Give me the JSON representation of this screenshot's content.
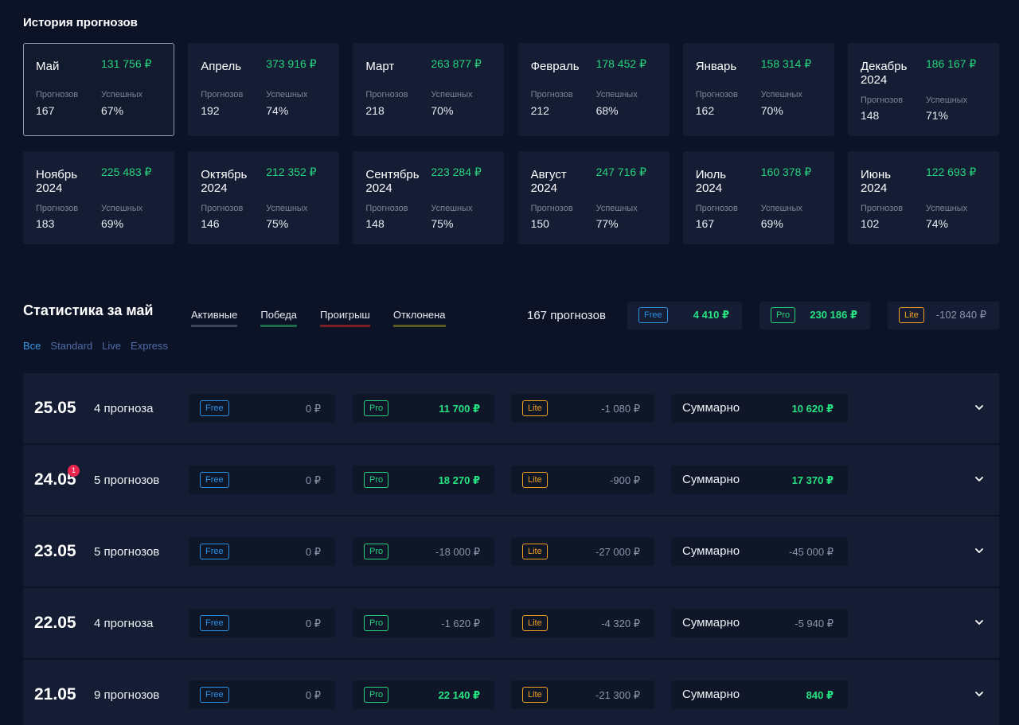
{
  "history": {
    "title": "История прогнозов",
    "labels": {
      "forecasts": "Прогнозов",
      "success": "Успешных"
    },
    "cards": [
      {
        "month": "Май",
        "amount": "131 756 ₽",
        "forecasts": "167",
        "success": "67%",
        "selected": true
      },
      {
        "month": "Апрель",
        "amount": "373 916 ₽",
        "forecasts": "192",
        "success": "74%"
      },
      {
        "month": "Март",
        "amount": "263 877 ₽",
        "forecasts": "218",
        "success": "70%"
      },
      {
        "month": "Февраль",
        "amount": "178 452 ₽",
        "forecasts": "212",
        "success": "68%"
      },
      {
        "month": "Январь",
        "amount": "158 314 ₽",
        "forecasts": "162",
        "success": "70%"
      },
      {
        "month": "Декабрь\n2024",
        "amount": "186 167 ₽",
        "forecasts": "148",
        "success": "71%"
      },
      {
        "month": "Ноябрь\n2024",
        "amount": "225 483 ₽",
        "forecasts": "183",
        "success": "69%"
      },
      {
        "month": "Октябрь\n2024",
        "amount": "212 352 ₽",
        "forecasts": "146",
        "success": "75%"
      },
      {
        "month": "Сентябрь\n2024",
        "amount": "223 284 ₽",
        "forecasts": "148",
        "success": "75%"
      },
      {
        "month": "Август\n2024",
        "amount": "247 716 ₽",
        "forecasts": "150",
        "success": "77%"
      },
      {
        "month": "Июль\n2024",
        "amount": "160 378 ₽",
        "forecasts": "167",
        "success": "69%"
      },
      {
        "month": "Июнь\n2024",
        "amount": "122 693 ₽",
        "forecasts": "102",
        "success": "74%"
      }
    ]
  },
  "stats": {
    "title": "Статистика за май",
    "filters": [
      {
        "label": "Активные",
        "color": "#3b4356"
      },
      {
        "label": "Победа",
        "color": "#1b6a4a"
      },
      {
        "label": "Проигрыш",
        "color": "#7a2027"
      },
      {
        "label": "Отклонена",
        "color": "#5b5a1d"
      }
    ],
    "count": "167 прогнозов",
    "summary": [
      {
        "type": "free",
        "badge": "Free",
        "amount": "4 410 ₽",
        "sign": "pos"
      },
      {
        "type": "pro",
        "badge": "Pro",
        "amount": "230 186 ₽",
        "sign": "pos"
      },
      {
        "type": "lite",
        "badge": "Lite",
        "amount": "-102 840 ₽",
        "sign": "neg"
      }
    ],
    "tabs": [
      {
        "label": "Все",
        "active": true
      },
      {
        "label": "Standard"
      },
      {
        "label": "Live"
      },
      {
        "label": "Express"
      }
    ],
    "total_label": "Суммарно",
    "days": [
      {
        "date": "25.05",
        "count": "4 прогноза",
        "free": "0 ₽",
        "pro": "11 700 ₽",
        "pro_sign": "pos",
        "lite": "-1 080 ₽",
        "lite_sign": "neg",
        "total": "10 620 ₽",
        "total_sign": "pos"
      },
      {
        "date": "24.05",
        "count": "5 прогнозов",
        "notif": "1",
        "free": "0 ₽",
        "pro": "18 270 ₽",
        "pro_sign": "pos",
        "lite": "-900 ₽",
        "lite_sign": "neg",
        "total": "17 370 ₽",
        "total_sign": "pos"
      },
      {
        "date": "23.05",
        "count": "5 прогнозов",
        "free": "0 ₽",
        "pro": "-18 000 ₽",
        "pro_sign": "neg",
        "lite": "-27 000 ₽",
        "lite_sign": "neg",
        "total": "-45 000 ₽",
        "total_sign": "neg"
      },
      {
        "date": "22.05",
        "count": "4 прогноза",
        "free": "0 ₽",
        "pro": "-1 620 ₽",
        "pro_sign": "neg",
        "lite": "-4 320 ₽",
        "lite_sign": "neg",
        "total": "-5 940 ₽",
        "total_sign": "neg"
      },
      {
        "date": "21.05",
        "count": "9 прогнозов",
        "free": "0 ₽",
        "pro": "22 140 ₽",
        "pro_sign": "pos",
        "lite": "-21 300 ₽",
        "lite_sign": "neg",
        "total": "840 ₽",
        "total_sign": "pos"
      }
    ],
    "badges": {
      "free": "Free",
      "pro": "Pro",
      "lite": "Lite"
    },
    "icons": {
      "expand": "chevron-down-icon"
    }
  }
}
